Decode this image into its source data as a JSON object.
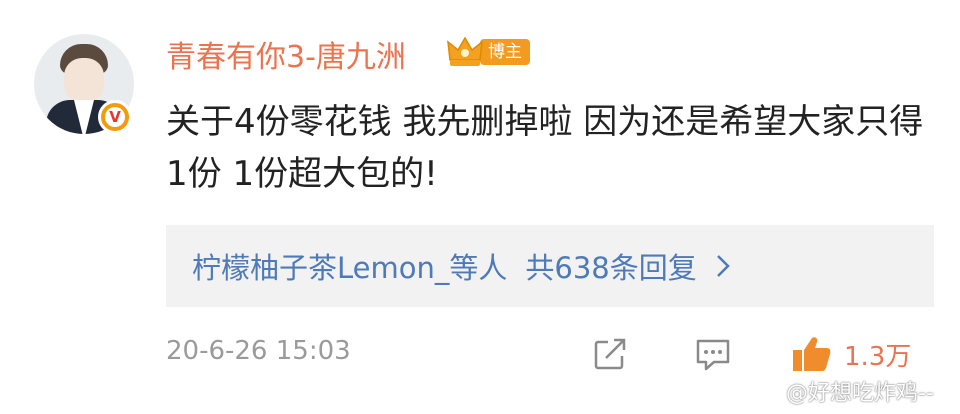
{
  "post": {
    "username": "青春有你3-唐九洲",
    "badge_label": "博主",
    "verified_label": "V",
    "text": "关于4份零花钱 我先删掉啦 因为还是希望大家只得1份 1份超大包的!",
    "replies_summary": {
      "names": "柠檬柚子茶Lemon_等人",
      "count_text": "共638条回复"
    },
    "timestamp": "20-6-26 15:03",
    "like_count": "1.3万"
  },
  "watermark": "@好想吃炸鸡--",
  "colors": {
    "username": "#eb7350",
    "link": "#4e7ab8",
    "badge": "#f39b1f",
    "text": "#222222",
    "meta": "#9a9a9a"
  },
  "icons": {
    "share": "share-icon",
    "comment": "comment-icon",
    "like": "thumbs-up-icon",
    "chevron": "chevron-right-icon",
    "crown": "crown-icon",
    "weibo": "weibo-logo-icon"
  }
}
